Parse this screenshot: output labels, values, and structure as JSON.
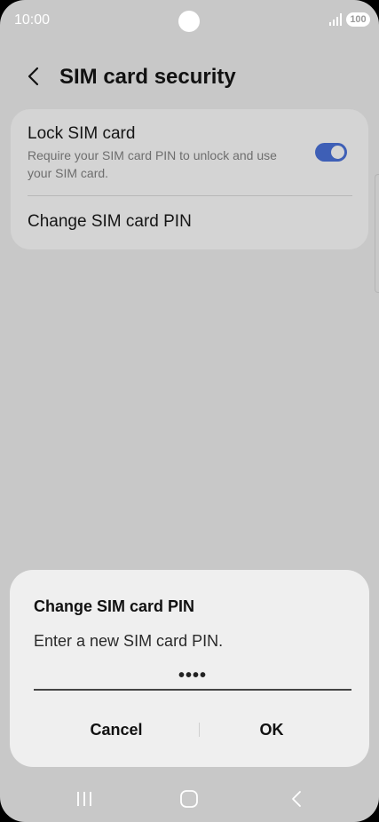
{
  "status_bar": {
    "time": "10:00",
    "battery": "100"
  },
  "header": {
    "title": "SIM card security"
  },
  "settings": {
    "lock_sim": {
      "title": "Lock SIM card",
      "description": "Require your SIM card PIN to unlock and use your SIM card.",
      "enabled": true
    },
    "change_pin": {
      "title": "Change SIM card PIN"
    }
  },
  "dialog": {
    "title": "Change SIM card PIN",
    "message": "Enter a new SIM card PIN.",
    "pin_value": "••••",
    "cancel_label": "Cancel",
    "ok_label": "OK"
  },
  "colors": {
    "accent": "#3e5fb6",
    "background": "#c8c8c8",
    "card": "#d4d4d4",
    "dialog": "#efefef"
  },
  "icons": {
    "back": "chevron-left-icon",
    "signal": "signal-icon",
    "recents": "recents-icon",
    "home": "home-icon",
    "nav_back": "back-icon"
  }
}
